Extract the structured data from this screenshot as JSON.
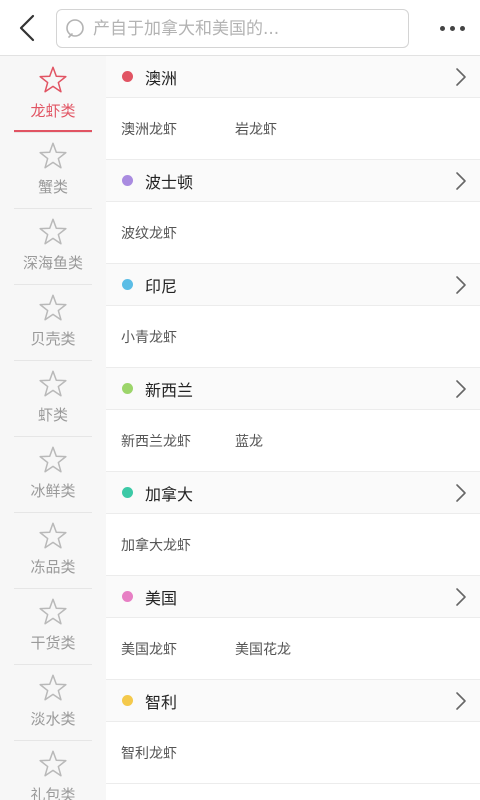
{
  "search": {
    "placeholder": "产自于加拿大和美国的..."
  },
  "sidebar": {
    "items": [
      {
        "label": "龙虾类",
        "active": true
      },
      {
        "label": "蟹类",
        "active": false
      },
      {
        "label": "深海鱼类",
        "active": false
      },
      {
        "label": "贝壳类",
        "active": false
      },
      {
        "label": "虾类",
        "active": false
      },
      {
        "label": "冰鲜类",
        "active": false
      },
      {
        "label": "冻品类",
        "active": false
      },
      {
        "label": "干货类",
        "active": false
      },
      {
        "label": "淡水类",
        "active": false
      },
      {
        "label": "礼包类",
        "active": false
      }
    ]
  },
  "groups": [
    {
      "name": "澳洲",
      "color": "#e15463",
      "products": [
        "澳洲龙虾",
        "岩龙虾"
      ]
    },
    {
      "name": "波士顿",
      "color": "#a98be0",
      "products": [
        "波纹龙虾"
      ]
    },
    {
      "name": "印尼",
      "color": "#5bbde6",
      "products": [
        "小青龙虾"
      ]
    },
    {
      "name": "新西兰",
      "color": "#9cd56a",
      "products": [
        "新西兰龙虾",
        "蓝龙"
      ]
    },
    {
      "name": "加拿大",
      "color": "#3cc9a6",
      "products": [
        "加拿大龙虾"
      ]
    },
    {
      "name": "美国",
      "color": "#e77fc4",
      "products": [
        "美国龙虾",
        "美国花龙"
      ]
    },
    {
      "name": "智利",
      "color": "#f4c94b",
      "products": [
        "智利龙虾"
      ]
    }
  ],
  "colors": {
    "accent": "#e15463",
    "sidebar_text": "#9a9a9a",
    "icon_gray": "#b9b9b9"
  },
  "icons": {
    "back": "chevron-left-icon",
    "search": "search-icon",
    "more": "more-dots-icon",
    "sidebar": "star-icon",
    "group": "chevron-right-icon"
  }
}
